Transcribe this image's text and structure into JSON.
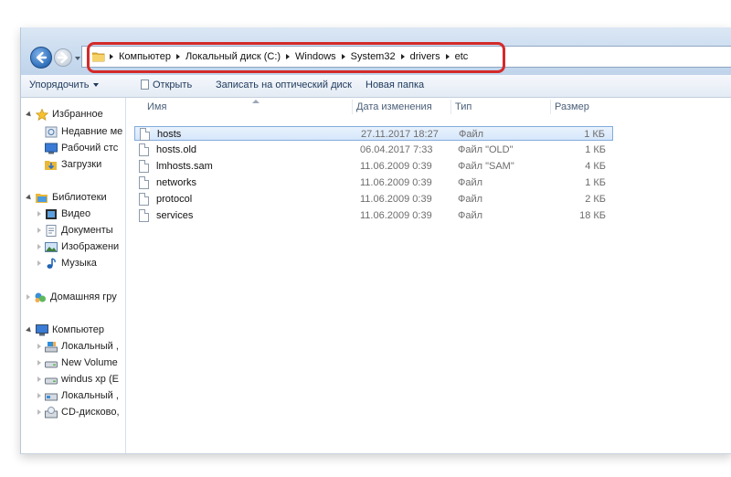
{
  "address": {
    "crumbs": [
      "Компьютер",
      "Локальный диск (C:)",
      "Windows",
      "System32",
      "drivers",
      "etc"
    ]
  },
  "toolbar": {
    "organize": "Упорядочить",
    "open": "Открыть",
    "burn": "Записать на оптический диск",
    "new_folder": "Новая папка"
  },
  "sidebar": {
    "favorites": "Избранное",
    "recent": "Недавние ме",
    "desktop": "Рабочий стс",
    "downloads": "Загрузки",
    "libraries": "Библиотеки",
    "video": "Видео",
    "documents": "Документы",
    "pictures": "Изображени",
    "music": "Музыка",
    "homegroup": "Домашняя гру",
    "computer": "Компьютер",
    "local_c": "Локальный ,",
    "new_volume": "New Volume",
    "windus": "windus xp (E",
    "local2": "Локальный ,",
    "cdrom": "CD-дисково,"
  },
  "columns": {
    "name": "Имя",
    "date": "Дата изменения",
    "type": "Тип",
    "size": "Размер"
  },
  "files": [
    {
      "name": "hosts",
      "date": "27.11.2017 18:27",
      "type": "Файл",
      "size": "1 КБ"
    },
    {
      "name": "hosts.old",
      "date": "06.04.2017 7:33",
      "type": "Файл \"OLD\"",
      "size": "1 КБ"
    },
    {
      "name": "lmhosts.sam",
      "date": "11.06.2009 0:39",
      "type": "Файл \"SAM\"",
      "size": "4 КБ"
    },
    {
      "name": "networks",
      "date": "11.06.2009 0:39",
      "type": "Файл",
      "size": "1 КБ"
    },
    {
      "name": "protocol",
      "date": "11.06.2009 0:39",
      "type": "Файл",
      "size": "2 КБ"
    },
    {
      "name": "services",
      "date": "11.06.2009 0:39",
      "type": "Файл",
      "size": "18 КБ"
    }
  ],
  "colors": {
    "highlight_box": "#d42a2a",
    "selection": "#d6e7fb",
    "titlebar": "#c9dbef"
  }
}
